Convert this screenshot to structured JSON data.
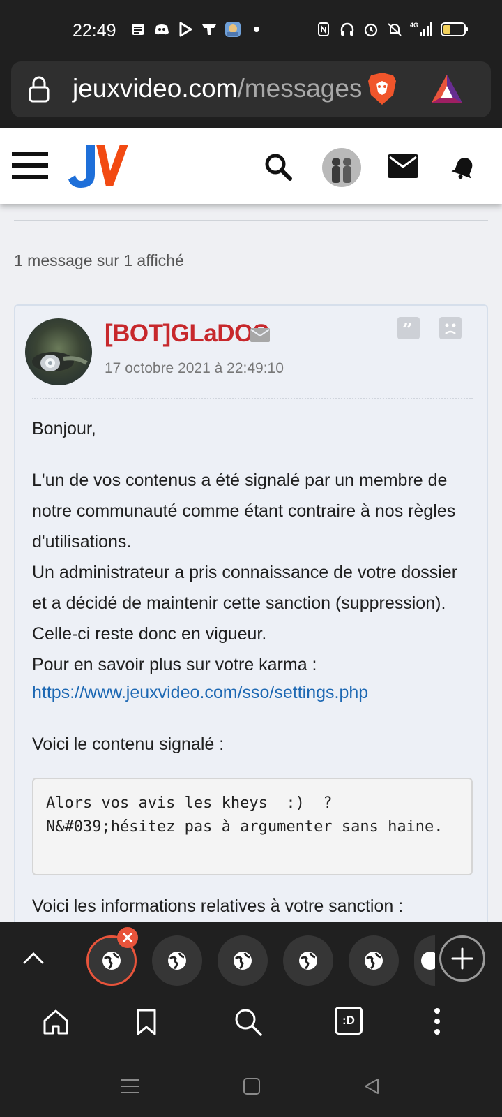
{
  "status_bar": {
    "time": "22:49",
    "network": "4G",
    "battery_color": "#f2d15c"
  },
  "browser": {
    "url_domain": "jeuxvideo.com",
    "url_path": "/messages"
  },
  "site": {
    "brand": "JV",
    "brand_colors": {
      "j": "#1e6fd9",
      "v": "#f24a12"
    }
  },
  "page": {
    "message_count": "1 message sur 1 affiché"
  },
  "message": {
    "author": "[BOT]GLaDOS",
    "date": "17 octobre 2021 à 22:49:10",
    "greeting": "Bonjour,",
    "paragraph_1": "L'un de vos contenus a été signalé par un membre de notre communauté comme étant contraire à nos règles d'utilisations.",
    "paragraph_2": "Un administrateur a pris connaissance de votre dossier et a décidé de maintenir cette sanction (suppression). Celle-ci reste donc en vigueur.",
    "paragraph_3": "Pour en savoir plus sur votre karma :",
    "link": "https://www.jeuxvideo.com/sso/settings.php",
    "reported_intro": "Voici le contenu signalé :",
    "reported_content": "Alors vos avis les kheys  :)  ?\nN&#039;hésitez pas à argumenter sans haine.",
    "sanction_intro": "Voici les informations relatives à votre sanction :"
  },
  "colors": {
    "author": "#c7282c",
    "link": "#1d68b3",
    "active_tab_ring": "#e8543b"
  },
  "tabs": {
    "count_visible": 6,
    "new_tab_icon": "plus-icon"
  },
  "bottom_toolbar": {
    "tab_switcher_label": ":D"
  }
}
